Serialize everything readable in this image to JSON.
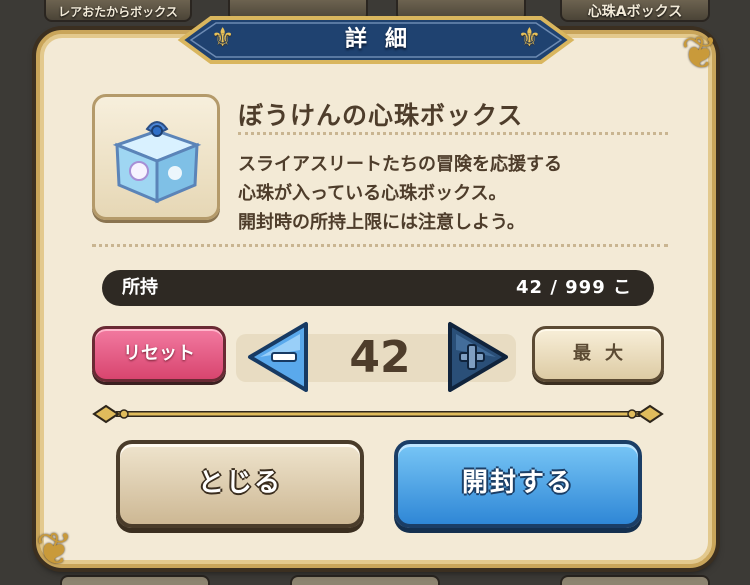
{
  "background_tabs": {
    "left_label": "レアおたからボックス",
    "right_label": "心珠Aボックス"
  },
  "dialog": {
    "title": "詳細"
  },
  "item": {
    "icon": "gem-box-icon",
    "name": "ぼうけんの心珠ボックス",
    "description_lines": [
      "スライアスリートたちの冒険を応援する",
      "心珠が入っている心珠ボックス。",
      "開封時の所持上限には注意しよう。"
    ]
  },
  "owned": {
    "label": "所持",
    "count_text": "42 / 999 こ"
  },
  "quantity": {
    "reset_label": "リセット",
    "value": "42",
    "max_label": "最大",
    "decrement_icon": "minus-arrow-icon",
    "increment_icon": "plus-arrow-icon"
  },
  "actions": {
    "close_label": "とじる",
    "open_label": "開封する"
  },
  "colors": {
    "panel_bg": "#f3ead6",
    "banner_blue": "#1f4270",
    "gold_trim": "#c9a55a",
    "reset_pink": "#e2557f",
    "open_blue": "#3c93dd",
    "decrement_blue": "#5aa9ec",
    "increment_dark_blue": "#2a4f78"
  }
}
